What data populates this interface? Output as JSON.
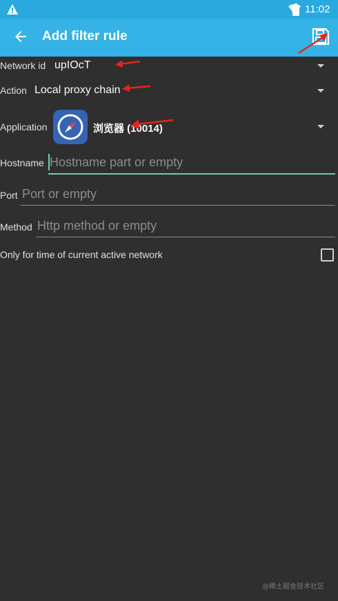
{
  "status_bar": {
    "time": "11:02",
    "icons": [
      "warning-icon",
      "wifi-icon",
      "battery-icon"
    ]
  },
  "app_bar": {
    "title": "Add filter rule",
    "back_icon": "arrow-back-icon",
    "save_icon": "save-icon"
  },
  "form": {
    "network_id": {
      "label": "Network id",
      "value": "upIOcT"
    },
    "action": {
      "label": "Action",
      "value": "Local proxy chain"
    },
    "application": {
      "label": "Application",
      "value": "浏览器 (10014)",
      "icon": "compass-icon"
    },
    "hostname": {
      "label": "Hostname",
      "placeholder": "Hostname part or empty"
    },
    "port": {
      "label": "Port",
      "placeholder": "Port or empty"
    },
    "method": {
      "label": "Method",
      "placeholder": "Http method or empty"
    },
    "active_network": {
      "label": "Only for time of current active network",
      "checked": false
    }
  },
  "watermark": "@稀土掘金技术社区",
  "colors": {
    "status_bar": "#29a9de",
    "app_bar": "#35b2e6",
    "background": "#2f2f2f",
    "accent": "#74c9b6",
    "annotation": "#e8231c"
  }
}
